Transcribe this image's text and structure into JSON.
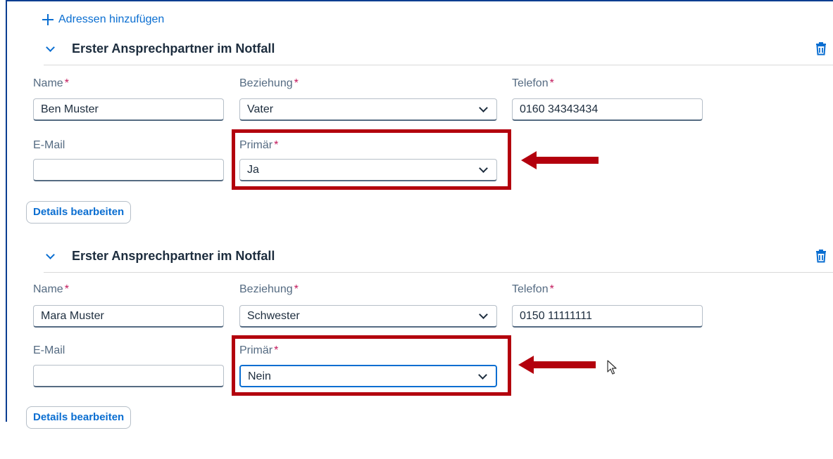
{
  "add_address": {
    "label": "Adressen hinzufügen",
    "icon": "plus-icon"
  },
  "required_marker": "*",
  "sections": [
    {
      "title": "Erster Ansprechpartner im Notfall",
      "fields": {
        "name": {
          "label": "Name",
          "value": "Ben Muster"
        },
        "relation": {
          "label": "Beziehung",
          "value": "Vater"
        },
        "phone": {
          "label": "Telefon",
          "value": "0160 34343434"
        },
        "email": {
          "label": "E-Mail",
          "value": ""
        },
        "primary": {
          "label": "Primär",
          "value": "Ja"
        }
      },
      "details_button": "Details bearbeiten"
    },
    {
      "title": "Erster Ansprechpartner im Notfall",
      "fields": {
        "name": {
          "label": "Name",
          "value": "Mara Muster"
        },
        "relation": {
          "label": "Beziehung",
          "value": "Schwester"
        },
        "phone": {
          "label": "Telefon",
          "value": "0150 11111111"
        },
        "email": {
          "label": "E-Mail",
          "value": ""
        },
        "primary": {
          "label": "Primär",
          "value": "Nein"
        }
      },
      "details_button": "Details bearbeiten"
    }
  ],
  "colors": {
    "accent": "#0a6ed1",
    "required": "#c2185b",
    "annotation": "#b3000d",
    "frame": "#0a3d91"
  },
  "icons": [
    "plus-icon",
    "chevron-down-icon",
    "trash-icon",
    "dropdown-chevron-icon",
    "arrow-left-icon",
    "mouse-cursor-icon"
  ]
}
